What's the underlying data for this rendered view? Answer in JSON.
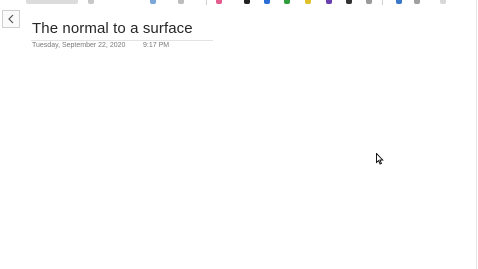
{
  "page": {
    "title": "The normal to a surface",
    "date": "Tuesday, September 22, 2020",
    "time": "9:17 PM"
  },
  "nav": {
    "back_icon": "chevron-left-icon"
  },
  "toolbar": {
    "pen_colors": [
      "#e35d8f",
      "#222222",
      "#2b6fd6",
      "#2e9e3e",
      "#e0c12c",
      "#6a3fb0",
      "#333333"
    ]
  },
  "cursor_icon": "mouse-pointer-icon"
}
